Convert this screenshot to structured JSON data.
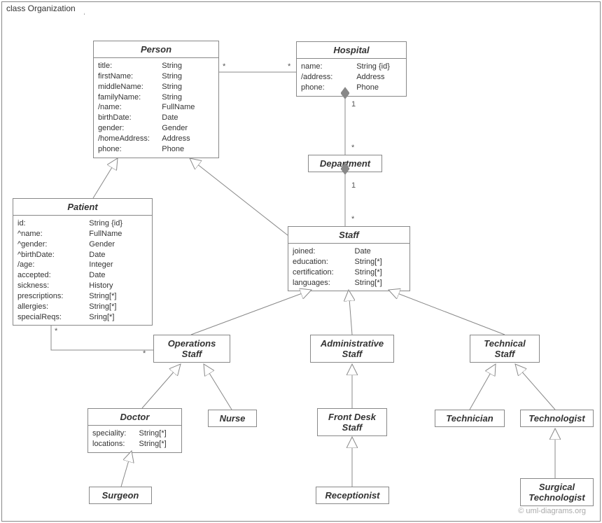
{
  "frame_label": "class Organization",
  "watermark": "© uml-diagrams.org",
  "classes": {
    "person": {
      "name": "Person",
      "attrs": [
        {
          "k": "title:",
          "v": "String"
        },
        {
          "k": "firstName:",
          "v": "String"
        },
        {
          "k": "middleName:",
          "v": "String"
        },
        {
          "k": "familyName:",
          "v": "String"
        },
        {
          "k": "/name:",
          "v": "FullName"
        },
        {
          "k": "birthDate:",
          "v": "Date"
        },
        {
          "k": "gender:",
          "v": "Gender"
        },
        {
          "k": "/homeAddress:",
          "v": "Address"
        },
        {
          "k": "phone:",
          "v": "Phone"
        }
      ]
    },
    "hospital": {
      "name": "Hospital",
      "attrs": [
        {
          "k": "name:",
          "v": "String {id}"
        },
        {
          "k": "/address:",
          "v": "Address"
        },
        {
          "k": "phone:",
          "v": "Phone"
        }
      ]
    },
    "department": {
      "name": "Department"
    },
    "patient": {
      "name": "Patient",
      "attrs": [
        {
          "k": "id:",
          "v": "String {id}"
        },
        {
          "k": "^name:",
          "v": "FullName"
        },
        {
          "k": "^gender:",
          "v": "Gender"
        },
        {
          "k": "^birthDate:",
          "v": "Date"
        },
        {
          "k": "/age:",
          "v": "Integer"
        },
        {
          "k": "accepted:",
          "v": "Date"
        },
        {
          "k": "sickness:",
          "v": "History"
        },
        {
          "k": "prescriptions:",
          "v": "String[*]"
        },
        {
          "k": "allergies:",
          "v": "String[*]"
        },
        {
          "k": "specialReqs:",
          "v": "Sring[*]"
        }
      ]
    },
    "staff": {
      "name": "Staff",
      "attrs": [
        {
          "k": "joined:",
          "v": "Date"
        },
        {
          "k": "education:",
          "v": "String[*]"
        },
        {
          "k": "certification:",
          "v": "String[*]"
        },
        {
          "k": "languages:",
          "v": "String[*]"
        }
      ]
    },
    "ops_staff": {
      "name": "Operations\nStaff",
      "name_l1": "Operations",
      "name_l2": "Staff"
    },
    "admin_staff": {
      "name": "Administrative\nStaff",
      "name_l1": "Administrative",
      "name_l2": "Staff"
    },
    "tech_staff": {
      "name": "Technical\nStaff",
      "name_l1": "Technical",
      "name_l2": "Staff"
    },
    "doctor": {
      "name": "Doctor",
      "attrs": [
        {
          "k": "speciality:",
          "v": "String[*]"
        },
        {
          "k": "locations:",
          "v": "String[*]"
        }
      ]
    },
    "nurse": {
      "name": "Nurse"
    },
    "front_desk": {
      "name": "Front Desk\nStaff",
      "name_l1": "Front Desk",
      "name_l2": "Staff"
    },
    "technician": {
      "name": "Technician"
    },
    "technologist": {
      "name": "Technologist"
    },
    "surgeon": {
      "name": "Surgeon"
    },
    "receptionist": {
      "name": "Receptionist"
    },
    "surg_tech": {
      "name": "Surgical\nTechnologist",
      "name_l1": "Surgical",
      "name_l2": "Technologist"
    }
  },
  "mults": {
    "person_hospital_l": "*",
    "person_hospital_r": "*",
    "hospital_dept_top": "1",
    "hospital_dept_bot": "*",
    "dept_staff_top": "1",
    "dept_staff_bot": "*",
    "patient_ops_l": "*",
    "patient_ops_r": "*"
  }
}
